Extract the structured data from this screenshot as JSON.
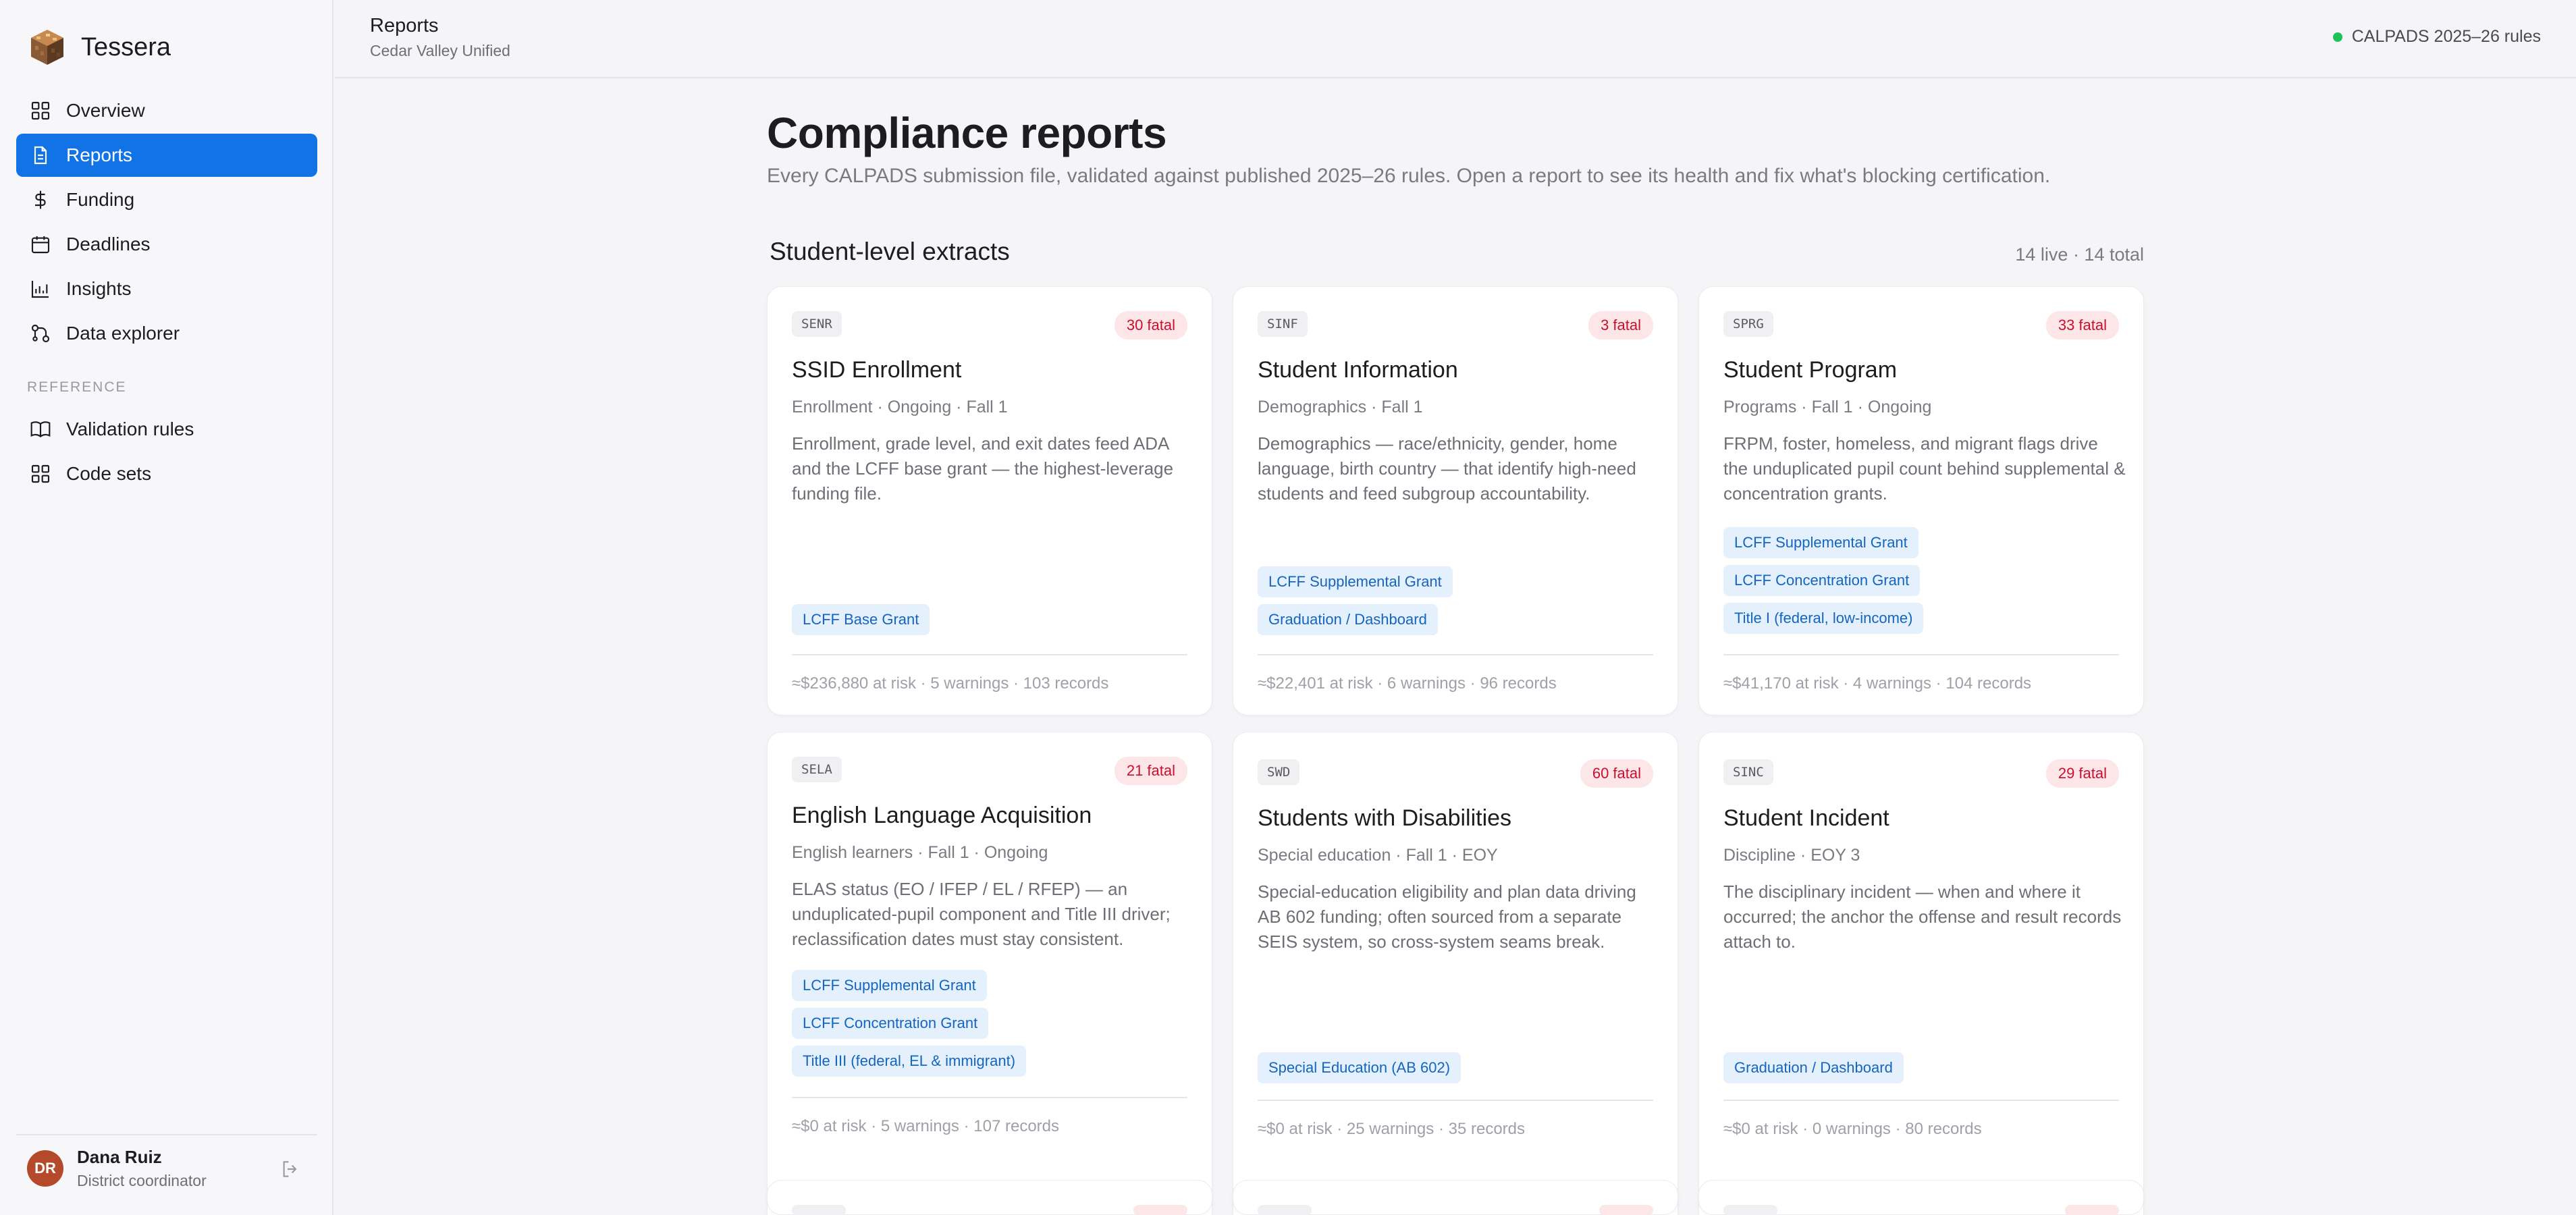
{
  "app": {
    "name": "Tessera"
  },
  "sidebar": {
    "items": [
      {
        "label": "Overview",
        "icon": "grid-icon"
      },
      {
        "label": "Reports",
        "icon": "document-icon",
        "active": true
      },
      {
        "label": "Funding",
        "icon": "dollar-icon"
      },
      {
        "label": "Deadlines",
        "icon": "calendar-icon"
      },
      {
        "label": "Insights",
        "icon": "bar-chart-icon"
      },
      {
        "label": "Data explorer",
        "icon": "graph-icon"
      }
    ],
    "reference_label": "REFERENCE",
    "reference_items": [
      {
        "label": "Validation rules",
        "icon": "book-icon"
      },
      {
        "label": "Code sets",
        "icon": "grid-icon"
      }
    ],
    "user": {
      "initials": "DR",
      "name": "Dana Ruiz",
      "role": "District coordinator"
    }
  },
  "header": {
    "title": "Reports",
    "subtitle": "Cedar Valley Unified",
    "rules_status": "CALPADS 2025–26 rules"
  },
  "main": {
    "title": "Compliance reports",
    "description": "Every CALPADS submission file, validated against published 2025–26 rules. Open a report to see its health and fix what's blocking certification.",
    "section": {
      "title": "Student-level extracts",
      "count": "14 live · 14 total"
    },
    "cards": [
      {
        "code": "SENR",
        "fatal": "30 fatal",
        "title": "SSID Enrollment",
        "meta": "Enrollment · Ongoing · Fall 1",
        "desc": "Enrollment, grade level, and exit dates feed ADA and the LCFF base grant — the highest-leverage funding file.",
        "tags": [
          "LCFF Base Grant"
        ],
        "footer": "≈$236,880 at risk · 5 warnings · 103 records"
      },
      {
        "code": "SINF",
        "fatal": "3 fatal",
        "title": "Student Information",
        "meta": "Demographics · Fall 1",
        "desc": "Demographics — race/ethnicity, gender, home language, birth country — that identify high-need students and feed subgroup accountability.",
        "tags": [
          "LCFF Supplemental Grant",
          "Graduation / Dashboard"
        ],
        "footer": "≈$22,401 at risk · 6 warnings · 96 records"
      },
      {
        "code": "SPRG",
        "fatal": "33 fatal",
        "title": "Student Program",
        "meta": "Programs · Fall 1 · Ongoing",
        "desc": "FRPM, foster, homeless, and migrant flags drive the unduplicated pupil count behind supplemental & concentration grants.",
        "tags": [
          "LCFF Supplemental Grant",
          "LCFF Concentration Grant",
          "Title I (federal, low-income)"
        ],
        "footer": "≈$41,170 at risk · 4 warnings · 104 records"
      },
      {
        "code": "SELA",
        "fatal": "21 fatal",
        "title": "English Language Acquisition",
        "meta": "English learners · Fall 1 · Ongoing",
        "desc": "ELAS status (EO / IFEP / EL / RFEP) — an unduplicated-pupil component and Title III driver; reclassification dates must stay consistent.",
        "tags": [
          "LCFF Supplemental Grant",
          "LCFF Concentration Grant",
          "Title III (federal, EL & immigrant)"
        ],
        "footer": "≈$0 at risk · 5 warnings · 107 records"
      },
      {
        "code": "SWD",
        "fatal": "60 fatal",
        "title": "Students with Disabilities",
        "meta": "Special education · Fall 1 · EOY",
        "desc": "Special-education eligibility and plan data driving AB 602 funding; often sourced from a separate SEIS system, so cross-system seams break.",
        "tags": [
          "Special Education (AB 602)"
        ],
        "footer": "≈$0 at risk · 25 warnings · 35 records"
      },
      {
        "code": "SINC",
        "fatal": "29 fatal",
        "title": "Student Incident",
        "meta": "Discipline · EOY 3",
        "desc": "The disciplinary incident — when and where it occurred; the anchor the offense and result records attach to.",
        "tags": [
          "Graduation / Dashboard"
        ],
        "footer": "≈$0 at risk · 0 warnings · 80 records"
      }
    ]
  }
}
